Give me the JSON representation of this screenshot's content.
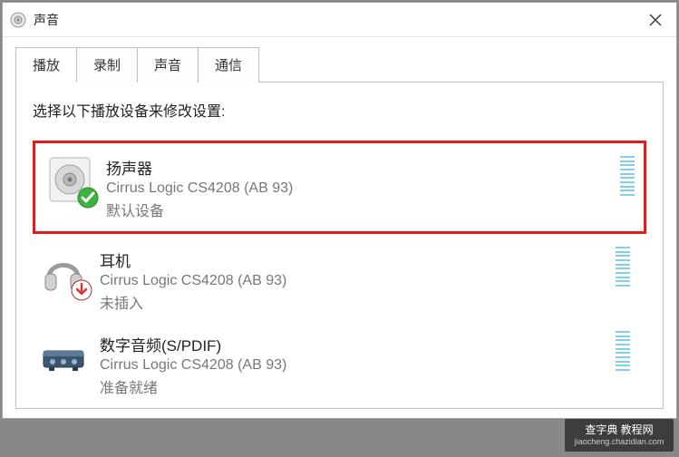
{
  "window": {
    "title": "声音"
  },
  "tabs": [
    {
      "label": "播放",
      "active": true
    },
    {
      "label": "录制",
      "active": false
    },
    {
      "label": "声音",
      "active": false
    },
    {
      "label": "通信",
      "active": false
    }
  ],
  "panel": {
    "instruction": "选择以下播放设备来修改设置:"
  },
  "devices": [
    {
      "name": "扬声器",
      "desc": "Cirrus Logic CS4208 (AB 93)",
      "status": "默认设备",
      "icon": "speaker-icon",
      "overlay": "check",
      "highlighted": true
    },
    {
      "name": "耳机",
      "desc": "Cirrus Logic CS4208 (AB 93)",
      "status": "未插入",
      "icon": "headphone-icon",
      "overlay": "down-arrow",
      "highlighted": false
    },
    {
      "name": "数字音频(S/PDIF)",
      "desc": "Cirrus Logic CS4208 (AB 93)",
      "status": "准备就绪",
      "icon": "spdif-icon",
      "overlay": null,
      "highlighted": false
    }
  ],
  "watermark": {
    "line1": "查字典  教程网",
    "line2": "jiaocheng.chazidian.com"
  }
}
